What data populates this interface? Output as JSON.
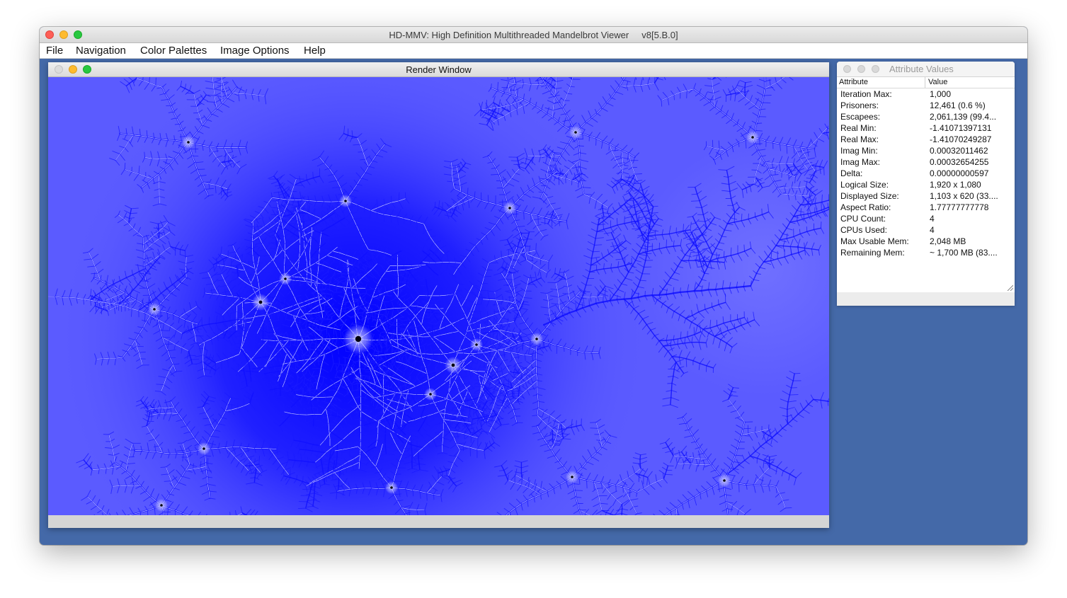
{
  "window": {
    "title": "HD-MMV: High Definition Multithreaded Mandelbrot Viewer     v8[5.B.0]"
  },
  "menu": [
    "File",
    "Navigation",
    "Color Palettes",
    "Image Options",
    "Help"
  ],
  "render_window": {
    "title": "Render Window"
  },
  "attributes_window": {
    "title": "Attribute Values",
    "headers": {
      "attribute": "Attribute",
      "value": "Value"
    },
    "rows": [
      {
        "key": "Iteration Max:",
        "value": "1,000"
      },
      {
        "key": "Prisoners:",
        "value": "12,461  (0.6 %)"
      },
      {
        "key": "Escapees:",
        "value": "2,061,139  (99.4..."
      },
      {
        "key": "Real Min:",
        "value": "-1.41071397131"
      },
      {
        "key": "Real Max:",
        "value": "-1.41070249287"
      },
      {
        "key": "Imag Min:",
        "value": "0.00032011462"
      },
      {
        "key": "Imag Max:",
        "value": "0.00032654255"
      },
      {
        "key": "Delta:",
        "value": "0.00000000597"
      },
      {
        "key": "Logical Size:",
        "value": "1,920 x 1,080"
      },
      {
        "key": "Displayed Size:",
        "value": "1,103 x 620  (33...."
      },
      {
        "key": "Aspect Ratio:",
        "value": "1.77777777778"
      },
      {
        "key": "CPU Count:",
        "value": "4"
      },
      {
        "key": "CPUs Used:",
        "value": "4"
      },
      {
        "key": "Max Usable Mem:",
        "value": "2,048 MB"
      },
      {
        "key": "Remaining Mem:",
        "value": "~ 1,700 MB  (83...."
      }
    ]
  },
  "colors": {
    "desktop_blue": "#4469a8",
    "fractal_background": "#5b5bff",
    "fractal_deep": "#0000ff",
    "fractal_filament": "#ffffff"
  }
}
